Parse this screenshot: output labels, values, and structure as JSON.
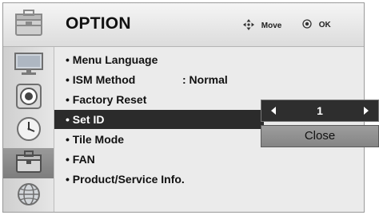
{
  "header": {
    "title": "OPTION",
    "icon": "toolbox-icon",
    "hints": [
      {
        "icon": "dpad-icon",
        "label": "Move"
      },
      {
        "icon": "ok-button-icon",
        "label": "OK"
      }
    ]
  },
  "sidebar": {
    "tabs": [
      {
        "icon": "monitor-icon",
        "active": false
      },
      {
        "icon": "speaker-icon",
        "active": false
      },
      {
        "icon": "clock-icon",
        "active": false
      },
      {
        "icon": "toolbox-icon",
        "active": true
      },
      {
        "icon": "globe-icon",
        "active": false
      }
    ]
  },
  "menu": {
    "items": [
      {
        "label": "• Menu Language",
        "value": ""
      },
      {
        "label": "• ISM Method",
        "value": ": Normal"
      },
      {
        "label": "• Factory Reset",
        "value": ""
      },
      {
        "label": "• Set ID",
        "value": "",
        "selected": true
      },
      {
        "label": "• Tile Mode",
        "value": ""
      },
      {
        "label": "• FAN",
        "value": ""
      },
      {
        "label": "• Product/Service Info.",
        "value": ""
      }
    ]
  },
  "popup": {
    "set_id_value": "1",
    "close_label": "Close"
  },
  "colors": {
    "selected_bg": "#2b2b2b",
    "panel_bg": "#ebebeb",
    "active_tab": "#8a8a8a"
  }
}
